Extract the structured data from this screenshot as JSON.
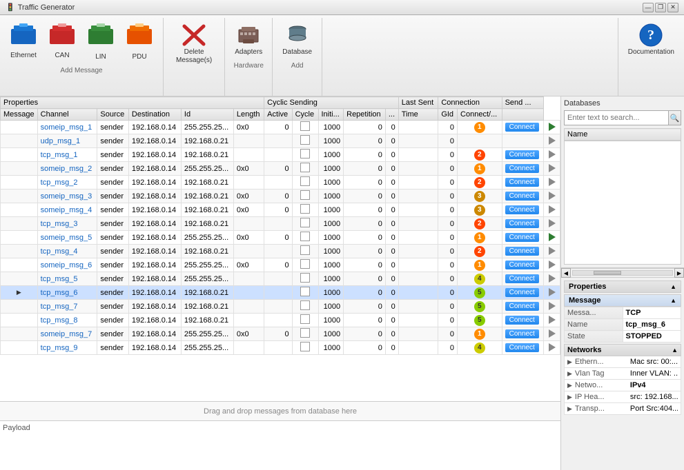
{
  "titleBar": {
    "appIcon": "🚦",
    "title": "Traffic Generator",
    "minimizeBtn": "—",
    "restoreBtn": "❐",
    "closeBtn": "✕"
  },
  "toolbar": {
    "groups": [
      {
        "id": "add-message",
        "label": "Add Message",
        "items": [
          {
            "id": "ethernet",
            "label": "Ethernet",
            "icon": "✉",
            "iconColor": "#1565C0"
          },
          {
            "id": "can",
            "label": "CAN",
            "icon": "✉",
            "iconColor": "#c62828"
          },
          {
            "id": "lin",
            "label": "LIN",
            "icon": "✉",
            "iconColor": "#2e7d32"
          },
          {
            "id": "pdu",
            "label": "PDU",
            "icon": "✉",
            "iconColor": "#e65100"
          }
        ]
      },
      {
        "id": "delete",
        "label": "",
        "items": [
          {
            "id": "delete-msg",
            "label": "Delete\nMessage(s)",
            "icon": "✕",
            "iconColor": "#c62828"
          }
        ]
      },
      {
        "id": "hardware",
        "label": "Hardware",
        "items": [
          {
            "id": "adapters",
            "label": "Adapters",
            "icon": "🔧",
            "iconColor": "#5d4037"
          }
        ]
      },
      {
        "id": "add-db",
        "label": "Add",
        "items": [
          {
            "id": "database",
            "label": "Database",
            "icon": "🗄",
            "iconColor": "#37474f"
          }
        ]
      }
    ],
    "documentation": {
      "label": "Documentation",
      "icon": "?"
    }
  },
  "table": {
    "groupHeaders": [
      {
        "label": "Properties",
        "colspan": 6
      },
      {
        "label": "Cyclic Sending",
        "colspan": 5
      },
      {
        "label": "Last Sent",
        "colspan": 1
      },
      {
        "label": "Connection",
        "colspan": 2
      },
      {
        "label": "Send ...",
        "colspan": 1
      }
    ],
    "columns": [
      "Message",
      "Channel",
      "Source",
      "Destination",
      "Id",
      "Length",
      "Active",
      "Cycle",
      "Initi...",
      "Repetition",
      "...",
      "Time",
      "GId",
      "Connect/...",
      ""
    ],
    "rows": [
      {
        "id": 1,
        "message": "someip_msg_1",
        "channel": "sender",
        "source": "192.168.0.14",
        "destination": "255.255.25...",
        "msgId": "0x0",
        "length": "0",
        "active": false,
        "cycle": "1000",
        "init": "0",
        "repetition": "0",
        "dots": "",
        "time": "0",
        "gid": 1,
        "gidColor": "gid-1",
        "connect": "Connect",
        "play": true,
        "selected": false
      },
      {
        "id": 2,
        "message": "udp_msg_1",
        "channel": "sender",
        "source": "192.168.0.14",
        "destination": "192.168.0.21",
        "msgId": "",
        "length": "",
        "active": false,
        "cycle": "1000",
        "init": "0",
        "repetition": "0",
        "dots": "",
        "time": "0",
        "gid": null,
        "gidColor": "",
        "connect": "",
        "play": false,
        "selected": false
      },
      {
        "id": 3,
        "message": "tcp_msg_1",
        "channel": "sender",
        "source": "192.168.0.14",
        "destination": "192.168.0.21",
        "msgId": "",
        "length": "",
        "active": false,
        "cycle": "1000",
        "init": "0",
        "repetition": "0",
        "dots": "",
        "time": "0",
        "gid": 2,
        "gidColor": "gid-2",
        "connect": "Connect",
        "play": false,
        "selected": false
      },
      {
        "id": 4,
        "message": "someip_msg_2",
        "channel": "sender",
        "source": "192.168.0.14",
        "destination": "255.255.25...",
        "msgId": "0x0",
        "length": "0",
        "active": false,
        "cycle": "1000",
        "init": "0",
        "repetition": "0",
        "dots": "",
        "time": "0",
        "gid": 1,
        "gidColor": "gid-1",
        "connect": "Connect",
        "play": false,
        "selected": false
      },
      {
        "id": 5,
        "message": "tcp_msg_2",
        "channel": "sender",
        "source": "192.168.0.14",
        "destination": "192.168.0.21",
        "msgId": "",
        "length": "",
        "active": false,
        "cycle": "1000",
        "init": "0",
        "repetition": "0",
        "dots": "",
        "time": "0",
        "gid": 2,
        "gidColor": "gid-2",
        "connect": "Connect",
        "play": false,
        "selected": false
      },
      {
        "id": 6,
        "message": "someip_msg_3",
        "channel": "sender",
        "source": "192.168.0.14",
        "destination": "192.168.0.21",
        "msgId": "0x0",
        "length": "0",
        "active": false,
        "cycle": "1000",
        "init": "0",
        "repetition": "0",
        "dots": "",
        "time": "0",
        "gid": 3,
        "gidColor": "gid-3",
        "connect": "Connect",
        "play": false,
        "selected": false
      },
      {
        "id": 7,
        "message": "someip_msg_4",
        "channel": "sender",
        "source": "192.168.0.14",
        "destination": "192.168.0.21",
        "msgId": "0x0",
        "length": "0",
        "active": false,
        "cycle": "1000",
        "init": "0",
        "repetition": "0",
        "dots": "",
        "time": "0",
        "gid": 3,
        "gidColor": "gid-3",
        "connect": "Connect",
        "play": false,
        "selected": false
      },
      {
        "id": 8,
        "message": "tcp_msg_3",
        "channel": "sender",
        "source": "192.168.0.14",
        "destination": "192.168.0.21",
        "msgId": "",
        "length": "",
        "active": false,
        "cycle": "1000",
        "init": "0",
        "repetition": "0",
        "dots": "",
        "time": "0",
        "gid": 2,
        "gidColor": "gid-2",
        "connect": "Connect",
        "play": false,
        "selected": false
      },
      {
        "id": 9,
        "message": "someip_msg_5",
        "channel": "sender",
        "source": "192.168.0.14",
        "destination": "255.255.25...",
        "msgId": "0x0",
        "length": "0",
        "active": false,
        "cycle": "1000",
        "init": "0",
        "repetition": "0",
        "dots": "",
        "time": "0",
        "gid": 1,
        "gidColor": "gid-1",
        "connect": "Connect",
        "play": true,
        "selected": false
      },
      {
        "id": 10,
        "message": "tcp_msg_4",
        "channel": "sender",
        "source": "192.168.0.14",
        "destination": "192.168.0.21",
        "msgId": "",
        "length": "",
        "active": false,
        "cycle": "1000",
        "init": "0",
        "repetition": "0",
        "dots": "",
        "time": "0",
        "gid": 2,
        "gidColor": "gid-2",
        "connect": "Connect",
        "play": false,
        "selected": false
      },
      {
        "id": 11,
        "message": "someip_msg_6",
        "channel": "sender",
        "source": "192.168.0.14",
        "destination": "255.255.25...",
        "msgId": "0x0",
        "length": "0",
        "active": false,
        "cycle": "1000",
        "init": "0",
        "repetition": "0",
        "dots": "",
        "time": "0",
        "gid": 1,
        "gidColor": "gid-1",
        "connect": "Connect",
        "play": false,
        "selected": false
      },
      {
        "id": 12,
        "message": "tcp_msg_5",
        "channel": "sender",
        "source": "192.168.0.14",
        "destination": "255.255.25...",
        "msgId": "",
        "length": "",
        "active": false,
        "cycle": "1000",
        "init": "0",
        "repetition": "0",
        "dots": "",
        "time": "0",
        "gid": 4,
        "gidColor": "gid-4",
        "connect": "Connect",
        "play": false,
        "selected": false
      },
      {
        "id": 13,
        "message": "tcp_msg_6",
        "channel": "sender",
        "source": "192.168.0.14",
        "destination": "192.168.0.21",
        "msgId": "",
        "length": "",
        "active": false,
        "cycle": "1000",
        "init": "0",
        "repetition": "0",
        "dots": "",
        "time": "0",
        "gid": 5,
        "gidColor": "gid-5",
        "connect": "Connect",
        "play": false,
        "selected": true,
        "hasArrow": true
      },
      {
        "id": 14,
        "message": "tcp_msg_7",
        "channel": "sender",
        "source": "192.168.0.14",
        "destination": "192.168.0.21",
        "msgId": "",
        "length": "",
        "active": false,
        "cycle": "1000",
        "init": "0",
        "repetition": "0",
        "dots": "",
        "time": "0",
        "gid": 5,
        "gidColor": "gid-5",
        "connect": "Connect",
        "play": false,
        "selected": false
      },
      {
        "id": 15,
        "message": "tcp_msg_8",
        "channel": "sender",
        "source": "192.168.0.14",
        "destination": "192.168.0.21",
        "msgId": "",
        "length": "",
        "active": false,
        "cycle": "1000",
        "init": "0",
        "repetition": "0",
        "dots": "",
        "time": "0",
        "gid": 5,
        "gidColor": "gid-5",
        "connect": "Connect",
        "play": false,
        "selected": false
      },
      {
        "id": 16,
        "message": "someip_msg_7",
        "channel": "sender",
        "source": "192.168.0.14",
        "destination": "255.255.25...",
        "msgId": "0x0",
        "length": "0",
        "active": false,
        "cycle": "1000",
        "init": "0",
        "repetition": "0",
        "dots": "",
        "time": "0",
        "gid": 1,
        "gidColor": "gid-1",
        "connect": "Connect",
        "play": false,
        "selected": false
      },
      {
        "id": 17,
        "message": "tcp_msg_9",
        "channel": "sender",
        "source": "192.168.0.14",
        "destination": "255.255.25...",
        "msgId": "",
        "length": "",
        "active": false,
        "cycle": "1000",
        "init": "0",
        "repetition": "0",
        "dots": "",
        "time": "0",
        "gid": 4,
        "gidColor": "gid-4",
        "connect": "Connect",
        "play": false,
        "selected": false
      }
    ]
  },
  "dropZone": "Drag and drop messages from database here",
  "payload": "Payload",
  "rightPanel": {
    "databases": {
      "title": "Databases",
      "searchPlaceholder": "Enter text to search...",
      "nameHeader": "Name"
    },
    "properties": {
      "title": "Properties",
      "message": {
        "header": "Message",
        "rows": [
          {
            "label": "Messa...",
            "value": "TCP"
          },
          {
            "label": "Name",
            "value": "tcp_msg_6"
          },
          {
            "label": "State",
            "value": "STOPPED"
          }
        ]
      },
      "networks": {
        "header": "Networks",
        "rows": [
          {
            "label": "Ethern...",
            "value": "Mac src: 00:...",
            "expand": true
          },
          {
            "label": "Vlan Tag",
            "value": "Inner VLAN: ...",
            "expand": true
          },
          {
            "label": "Netwo...",
            "value": "IPv4",
            "expand": false
          },
          {
            "label": "IP Hea...",
            "value": "src: 192.168...",
            "expand": true
          },
          {
            "label": "Transp...",
            "value": "Port Src:404...",
            "expand": true
          }
        ]
      }
    }
  }
}
